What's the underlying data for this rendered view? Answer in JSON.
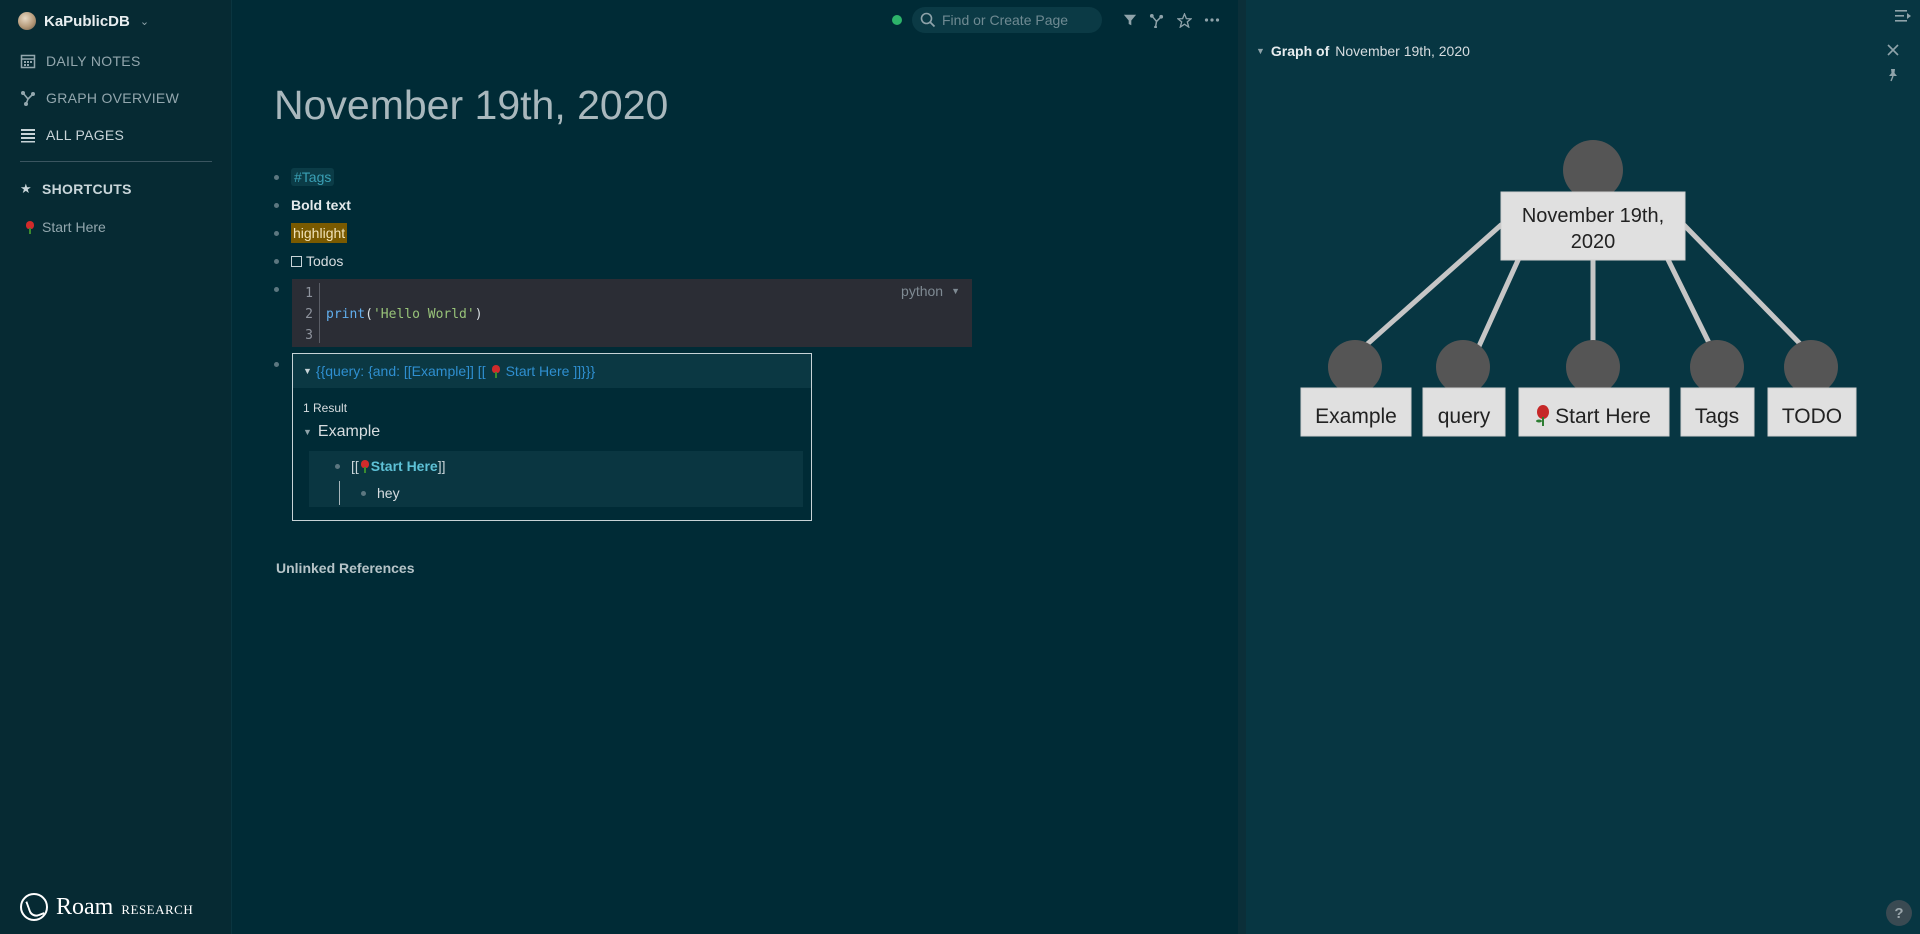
{
  "sidebar": {
    "db_name": "KaPublicDB",
    "nav": [
      {
        "label": "DAILY NOTES",
        "icon": "calendar-icon"
      },
      {
        "label": "GRAPH OVERVIEW",
        "icon": "graph-icon"
      },
      {
        "label": "ALL PAGES",
        "icon": "list-icon"
      }
    ],
    "shortcuts_label": "SHORTCUTS",
    "shortcuts": [
      {
        "label": "Start Here",
        "icon": "rose-icon"
      }
    ],
    "brand_name": "Roam",
    "brand_sub": "RESEARCH"
  },
  "topbar": {
    "search_placeholder": "Find or Create Page",
    "sync_status_color": "#2db36a"
  },
  "page": {
    "title": "November 19th, 2020",
    "blocks": {
      "tag": "#Tags",
      "bold": "Bold text",
      "highlight": "highlight",
      "todo": "Todos"
    },
    "code": {
      "language": "python",
      "line_numbers": [
        "1",
        "2",
        "3"
      ],
      "fn": "print",
      "open": "(",
      "string": "'Hello World'",
      "close": ")"
    },
    "query": {
      "expression_prefix": "{{query:  {and: [[Example]] [[",
      "expression_page": "Start Here",
      "expression_suffix": "]]}}}",
      "result_count": "1 Result",
      "group": "Example",
      "result_open": "[[",
      "result_link": "Start Here",
      "result_close": "]]",
      "child": "hey"
    },
    "unlinked_references": "Unlinked References"
  },
  "right_panel": {
    "title_prefix": "Graph of",
    "title_page": "November 19th, 2020",
    "graph": {
      "root": {
        "line1": "November 19th,",
        "line2": "2020"
      },
      "children": [
        "Example",
        "query",
        "Start Here",
        "Tags",
        "TODO"
      ]
    }
  },
  "colors": {
    "background": "#002b36",
    "sidebar": "#062a33",
    "panel": "#073642",
    "link": "#2f8fd0",
    "highlight": "#7a5a00",
    "graph_node": "#555555",
    "graph_label_bg": "#e0e0e0"
  }
}
